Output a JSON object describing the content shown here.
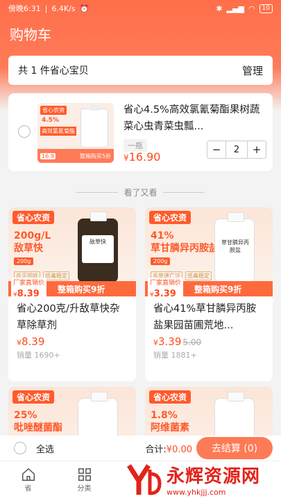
{
  "status": {
    "time": "傍晚6:31",
    "speed": "6.4K/s",
    "battery": "10"
  },
  "header": {
    "title": "购物车"
  },
  "summary": {
    "count_text": "共 1 件省心宝贝",
    "manage": "管理"
  },
  "cart_item": {
    "title": "省心4.5%高效氯氰菊酯果树蔬菜心虫青菜虫瓢...",
    "spec": "一瓶",
    "price_symbol": "¥",
    "price": "16.90",
    "qty": "2",
    "minus": "−",
    "plus": "+",
    "thumb": {
      "brand": "省心农资",
      "pct": "4.5%",
      "tag": "高效氯氰菊酯",
      "band_left": "16.9",
      "band_right": "整箱购买5折"
    }
  },
  "recommend_label": "看了又看",
  "products": [
    {
      "brand": "省心农资",
      "spec": "200g/L",
      "name_short": "敌草快",
      "vol": "200g",
      "chip1": "杀灭彻底",
      "chip2": "低毒稳定",
      "bottle_label": "敌草快",
      "tag_top": "厂家直销价",
      "tag_price": "8.39",
      "promo": "整箱购买9折",
      "title": "省心200克/升敌草快杂草除草剂",
      "price": "8.39",
      "old_price": "",
      "sold": "销量 1690+"
    },
    {
      "brand": "省心农资",
      "spec": "41%",
      "name_short": "草甘膦异丙胺盐",
      "vol": "200g",
      "chip1": "杀草谱广泛",
      "chip2": "低毒稳定",
      "bottle_label": "草甘膦异丙胺盐",
      "tag_top": "厂家直销价",
      "tag_price": "3.39",
      "promo": "整箱购买9折",
      "title": "省心41%草甘膦异丙胺盐果园苗圃荒地...",
      "price": "3.39",
      "old_price": "5.00",
      "sold": "销量 1881+"
    },
    {
      "brand": "省心农资",
      "spec": "25%",
      "name_short": "吡唑醚菌酯"
    },
    {
      "brand": "省心农资",
      "spec": "1.8%",
      "name_short": "阿维菌素"
    }
  ],
  "checkout": {
    "select_all": "全选",
    "total_label": "合计:",
    "total": "¥0.00",
    "button": "去结算 (0)"
  },
  "tabs": [
    {
      "label": "省",
      "icon": "home-icon"
    },
    {
      "label": "分类",
      "icon": "grid-icon"
    }
  ],
  "watermark": {
    "name": "永辉资源网",
    "url": "www.yhkjjj.com"
  },
  "colors": {
    "accent": "#ff6f4a",
    "price": "#ff4b1f"
  }
}
